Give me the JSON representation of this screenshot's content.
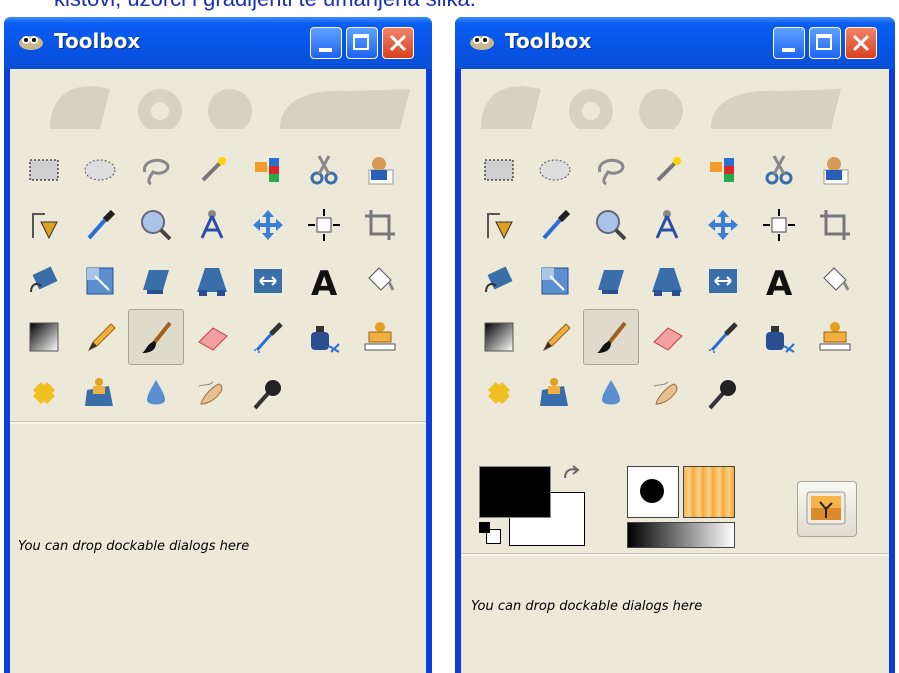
{
  "caption": "kistovi, uzorci i gradijenti te umanjena slika.",
  "windows": [
    {
      "title": "Toolbox",
      "drop_text": "You can drop dockable dialogs here",
      "buttons": [
        "minimize",
        "maximize",
        "close"
      ],
      "show_indicators": false
    },
    {
      "title": "Toolbox",
      "drop_text": "You can drop dockable dialogs here",
      "buttons": [
        "minimize",
        "maximize",
        "close"
      ],
      "show_indicators": true
    }
  ],
  "tools": [
    "rect-select-icon",
    "ellipse-select-icon",
    "free-select-icon",
    "fuzzy-select-icon",
    "by-color-select-icon",
    "scissors-select-icon",
    "foreground-select-icon",
    "paths-icon",
    "color-picker-icon",
    "zoom-icon",
    "measure-icon",
    "move-icon",
    "align-icon",
    "crop-icon",
    "rotate-icon",
    "scale-icon",
    "shear-icon",
    "perspective-icon",
    "flip-icon",
    "text-icon",
    "bucket-fill-icon",
    "blend-icon",
    "pencil-icon",
    "paintbrush-icon",
    "eraser-icon",
    "airbrush-icon",
    "ink-icon",
    "clone-icon",
    "heal-icon",
    "perspective-clone-icon",
    "blur-icon",
    "smudge-icon",
    "dodge-burn-icon"
  ],
  "selected_tool": "paintbrush-icon",
  "colors": {
    "titlebar": "#0a5ef2",
    "window_bg": "#ece9d8",
    "foreground": "#000000",
    "background": "#ffffff",
    "caption": "#1a2fb8"
  }
}
